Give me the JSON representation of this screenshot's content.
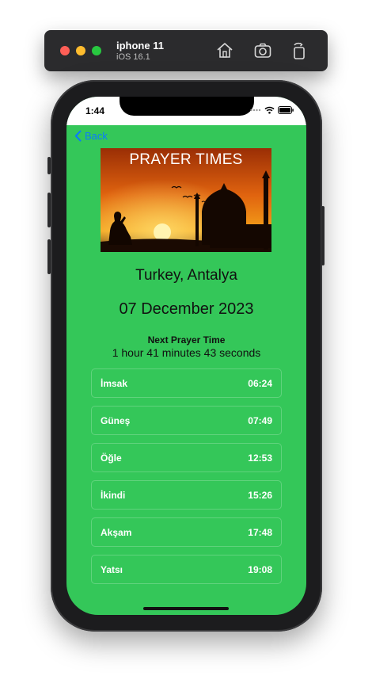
{
  "simulator": {
    "device_name": "iphone 11",
    "os_version": "iOS 16.1"
  },
  "status_bar": {
    "time": "1:44"
  },
  "nav": {
    "back_label": "Back"
  },
  "banner": {
    "title": "PRAYER TIMES"
  },
  "location": "Turkey, Antalya",
  "date": "07 December 2023",
  "next_prayer": {
    "label": "Next Prayer Time",
    "countdown": "1 hour 41 minutes 43 seconds"
  },
  "prayers": [
    {
      "name": "İmsak",
      "time": "06:24"
    },
    {
      "name": "Güneş",
      "time": "07:49"
    },
    {
      "name": "Öğle",
      "time": "12:53"
    },
    {
      "name": "İkindi",
      "time": "15:26"
    },
    {
      "name": "Akşam",
      "time": "17:48"
    },
    {
      "name": "Yatsı",
      "time": "19:08"
    }
  ],
  "colors": {
    "screen_background": "#34c759",
    "accent_link": "#0a7aff"
  }
}
